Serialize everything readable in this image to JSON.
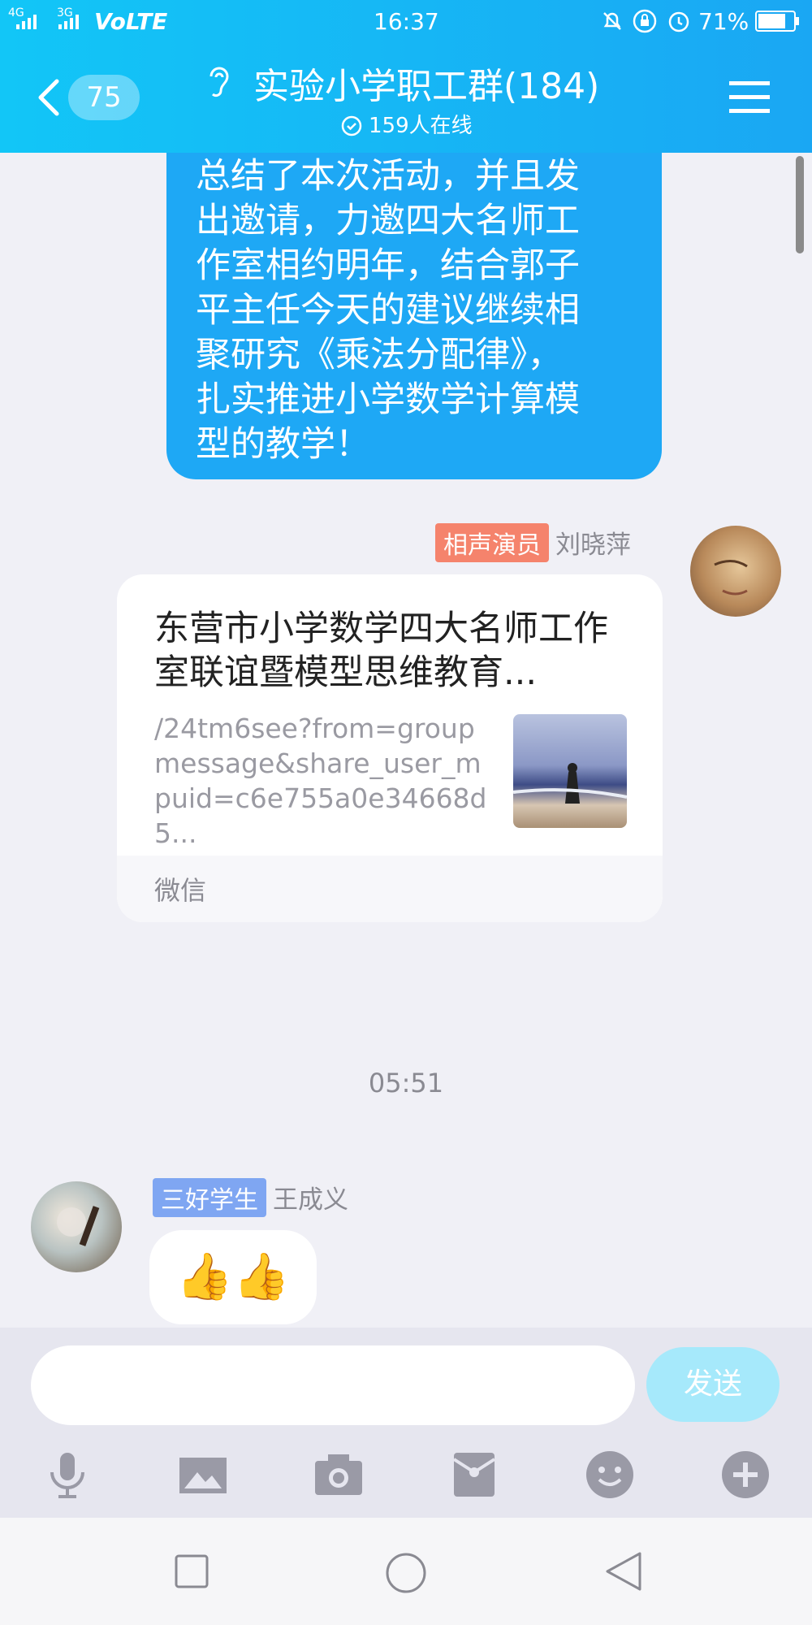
{
  "status_bar": {
    "network1": "4G",
    "network2": "3G",
    "volte": "VoLTE",
    "time": "16:37",
    "battery": "71%"
  },
  "header": {
    "unread_count": "75",
    "group_title": "实验小学职工群(184)",
    "online": "159人在线"
  },
  "messages": {
    "msg1": {
      "text": "总结了本次活动，并且发\n出邀请，力邀四大名师工\n作室相约明年，结合郭子\n平主任今天的建议继续相\n聚研究《乘法分配律》，\n扎实推进小学数学计算模\n型的教学！"
    },
    "msg2": {
      "badge": "相声演员",
      "badge_color": "#f5836c",
      "sender": "刘晓萍",
      "card_title": "东营市小学数学四大名师工作室联谊暨模型思维教育...",
      "card_desc": "/24tm6see?from=groupmessage&share_user_mpuid=c6e755a0e34668d5...",
      "card_source": "微信"
    },
    "timestamp": "05:51",
    "msg3": {
      "badge": "三好学生",
      "badge_color": "#7fa6f2",
      "sender": "王成义",
      "text": "👍👍"
    }
  },
  "input": {
    "placeholder": "",
    "send_label": "发送"
  },
  "toolbar": [
    "microphone-icon",
    "image-icon",
    "camera-icon",
    "red-packet-icon",
    "emoji-icon",
    "plus-icon"
  ],
  "nav": [
    "recent-apps-icon",
    "home-icon",
    "back-nav-icon"
  ],
  "colors": {
    "header_start": "#12c6f7",
    "header_end": "#1aa7f3",
    "bubble": "#1ea8f5",
    "send": "#a6e9fb"
  }
}
